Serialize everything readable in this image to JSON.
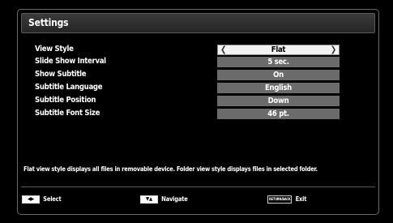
{
  "header": {
    "title": "Settings"
  },
  "settings": [
    {
      "label": "View Style",
      "value": "Flat",
      "selected": true
    },
    {
      "label": "Slide Show Interval",
      "value": "5 sec."
    },
    {
      "label": "Show Subtitle",
      "value": "On"
    },
    {
      "label": "Subtitle Language",
      "value": "English"
    },
    {
      "label": "Subtitle Position",
      "value": "Down"
    },
    {
      "label": "Subtitle Font Size",
      "value": "46 pt."
    }
  ],
  "description": "Flat view style displays all files in removable device. Folder view style displays files in selected folder.",
  "footer": {
    "select": {
      "keys": "◀▶",
      "label": "Select"
    },
    "navigate": {
      "keys": "▼▲",
      "label": "Navigate"
    },
    "exit": {
      "key": "RETURN/BACK",
      "label": "Exit"
    }
  },
  "colors": {
    "background": "#000000",
    "value_box": "#6b6b6b",
    "selected_value_box": "#f2f2f2",
    "border": "#6a6a6a"
  },
  "icons": {
    "left_arrow": "chevron-left-icon",
    "right_arrow": "chevron-right-icon"
  }
}
